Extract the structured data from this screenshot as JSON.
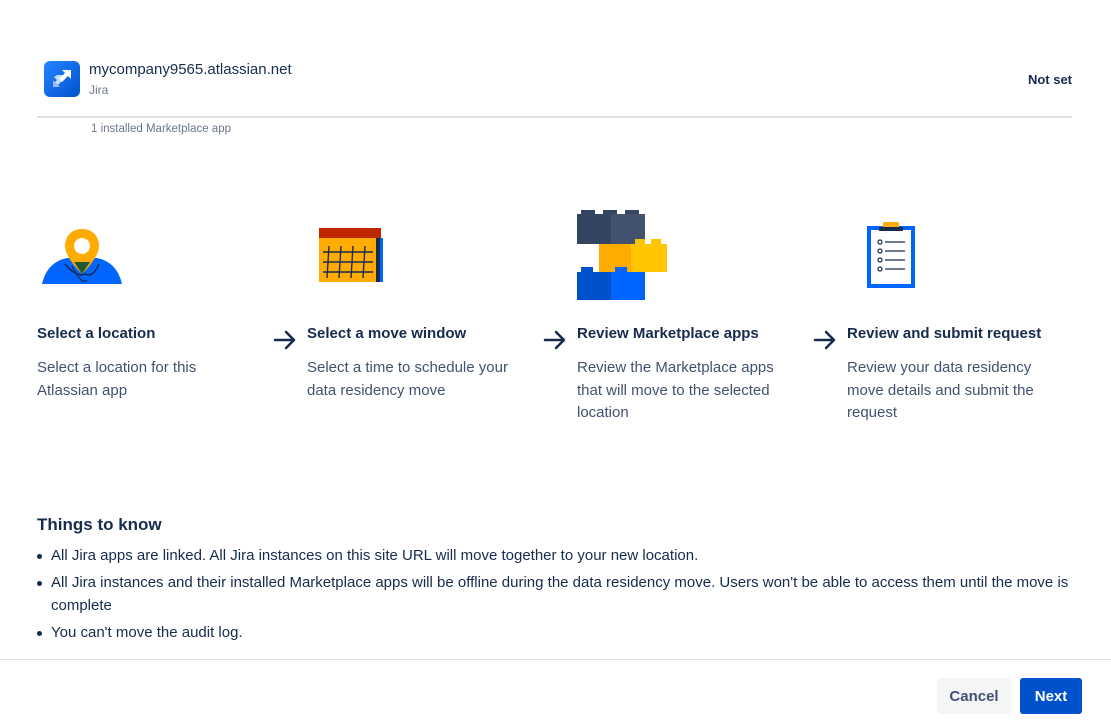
{
  "site": {
    "url": "mycompany9565.atlassian.net",
    "product": "Jira",
    "status": "Not set",
    "apps_count": "1 installed Marketplace app"
  },
  "steps": [
    {
      "title": "Select a location",
      "description": "Select a location for this Atlassian app",
      "icon": "location-person-icon"
    },
    {
      "title": "Select a move window",
      "description": "Select a time to schedule your data residency move",
      "icon": "calendar-icon"
    },
    {
      "title": "Review Marketplace apps",
      "description": "Review the Marketplace apps that will move to the selected location",
      "icon": "building-blocks-icon"
    },
    {
      "title": "Review and submit request",
      "description": "Review your data residency move details and submit the request",
      "icon": "clipboard-icon"
    }
  ],
  "things_to_know": {
    "title": "Things to know",
    "items": [
      "All Jira apps are linked. All Jira instances on this site URL will move together to your new location.",
      "All Jira instances and their installed Marketplace apps will be offline during the data residency move. Users won't be able to access them until the move is complete",
      "You can't move the audit log."
    ]
  },
  "actions": {
    "cancel_label": "Cancel",
    "next_label": "Next"
  },
  "colors": {
    "primary": "#0052cc",
    "jira_blue": "#2684ff",
    "accent_yellow": "#ffab00",
    "text": "#172b4d",
    "subtle_text": "#6b778c"
  }
}
